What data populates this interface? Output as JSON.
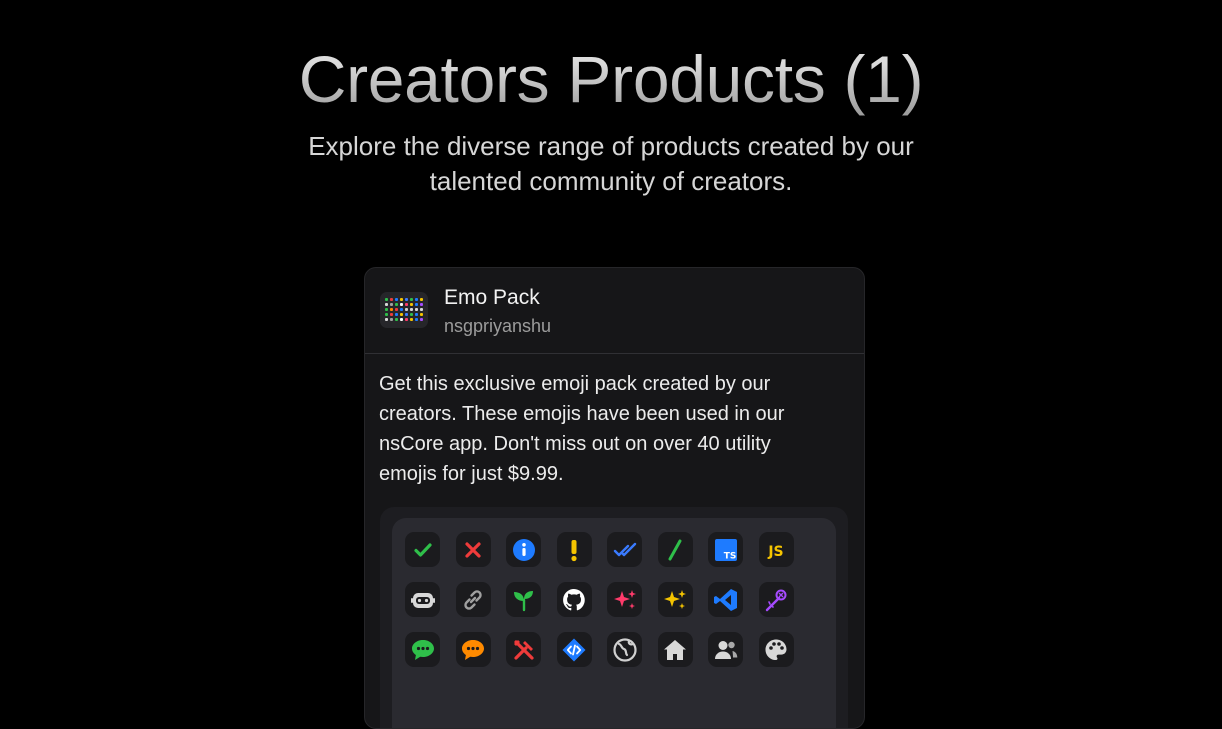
{
  "header": {
    "title": "Creators Products (1)",
    "subtitle": "Explore the diverse range of products created by our talented community of creators."
  },
  "product": {
    "name": "Emo Pack",
    "creator": "nsgpriyanshu",
    "description": "Get this exclusive emoji pack created by our creators. These emojis have been used in our nsCore app. Don't miss out on over 40 utility emojis for just $9.99.",
    "emojis": [
      {
        "icon": "check-icon",
        "color": "#2fbf4a"
      },
      {
        "icon": "cross-icon",
        "color": "#ef3b3b"
      },
      {
        "icon": "info-icon",
        "color": "#1e7bff"
      },
      {
        "icon": "exclamation-icon",
        "color": "#f5c400"
      },
      {
        "icon": "double-check-icon",
        "color": "#3a7bff"
      },
      {
        "icon": "slash-icon",
        "color": "#2fbf4a"
      },
      {
        "icon": "typescript-icon",
        "color": "#1e7bff",
        "text": "TS"
      },
      {
        "icon": "javascript-icon",
        "color": "#f5c400",
        "text": "JS"
      },
      {
        "icon": "robot-icon",
        "color": "#d8d8d8"
      },
      {
        "icon": "link-icon",
        "color": "#a0a0a0"
      },
      {
        "icon": "sprout-icon",
        "color": "#2fbf4a"
      },
      {
        "icon": "github-icon",
        "color": "#ffffff"
      },
      {
        "icon": "sparkles-pink-icon",
        "color": "#ff3b6b"
      },
      {
        "icon": "sparkles-yellow-icon",
        "color": "#f5c400"
      },
      {
        "icon": "vscode-icon",
        "color": "#1e7bff"
      },
      {
        "icon": "magic-wand-icon",
        "color": "#a64bff"
      },
      {
        "icon": "chat-bubble-icon",
        "color": "#2fbf4a"
      },
      {
        "icon": "speech-bubble-icon",
        "color": "#ff8a00"
      },
      {
        "icon": "tools-icon",
        "color": "#ef3b3b"
      },
      {
        "icon": "code-icon",
        "color": "#1e7bff"
      },
      {
        "icon": "globe-icon",
        "color": "#d0d0d0"
      },
      {
        "icon": "home-icon",
        "color": "#d8d8d8"
      },
      {
        "icon": "users-icon",
        "color": "#d8d8d8"
      },
      {
        "icon": "palette-icon",
        "color": "#d8d8d8"
      }
    ]
  }
}
